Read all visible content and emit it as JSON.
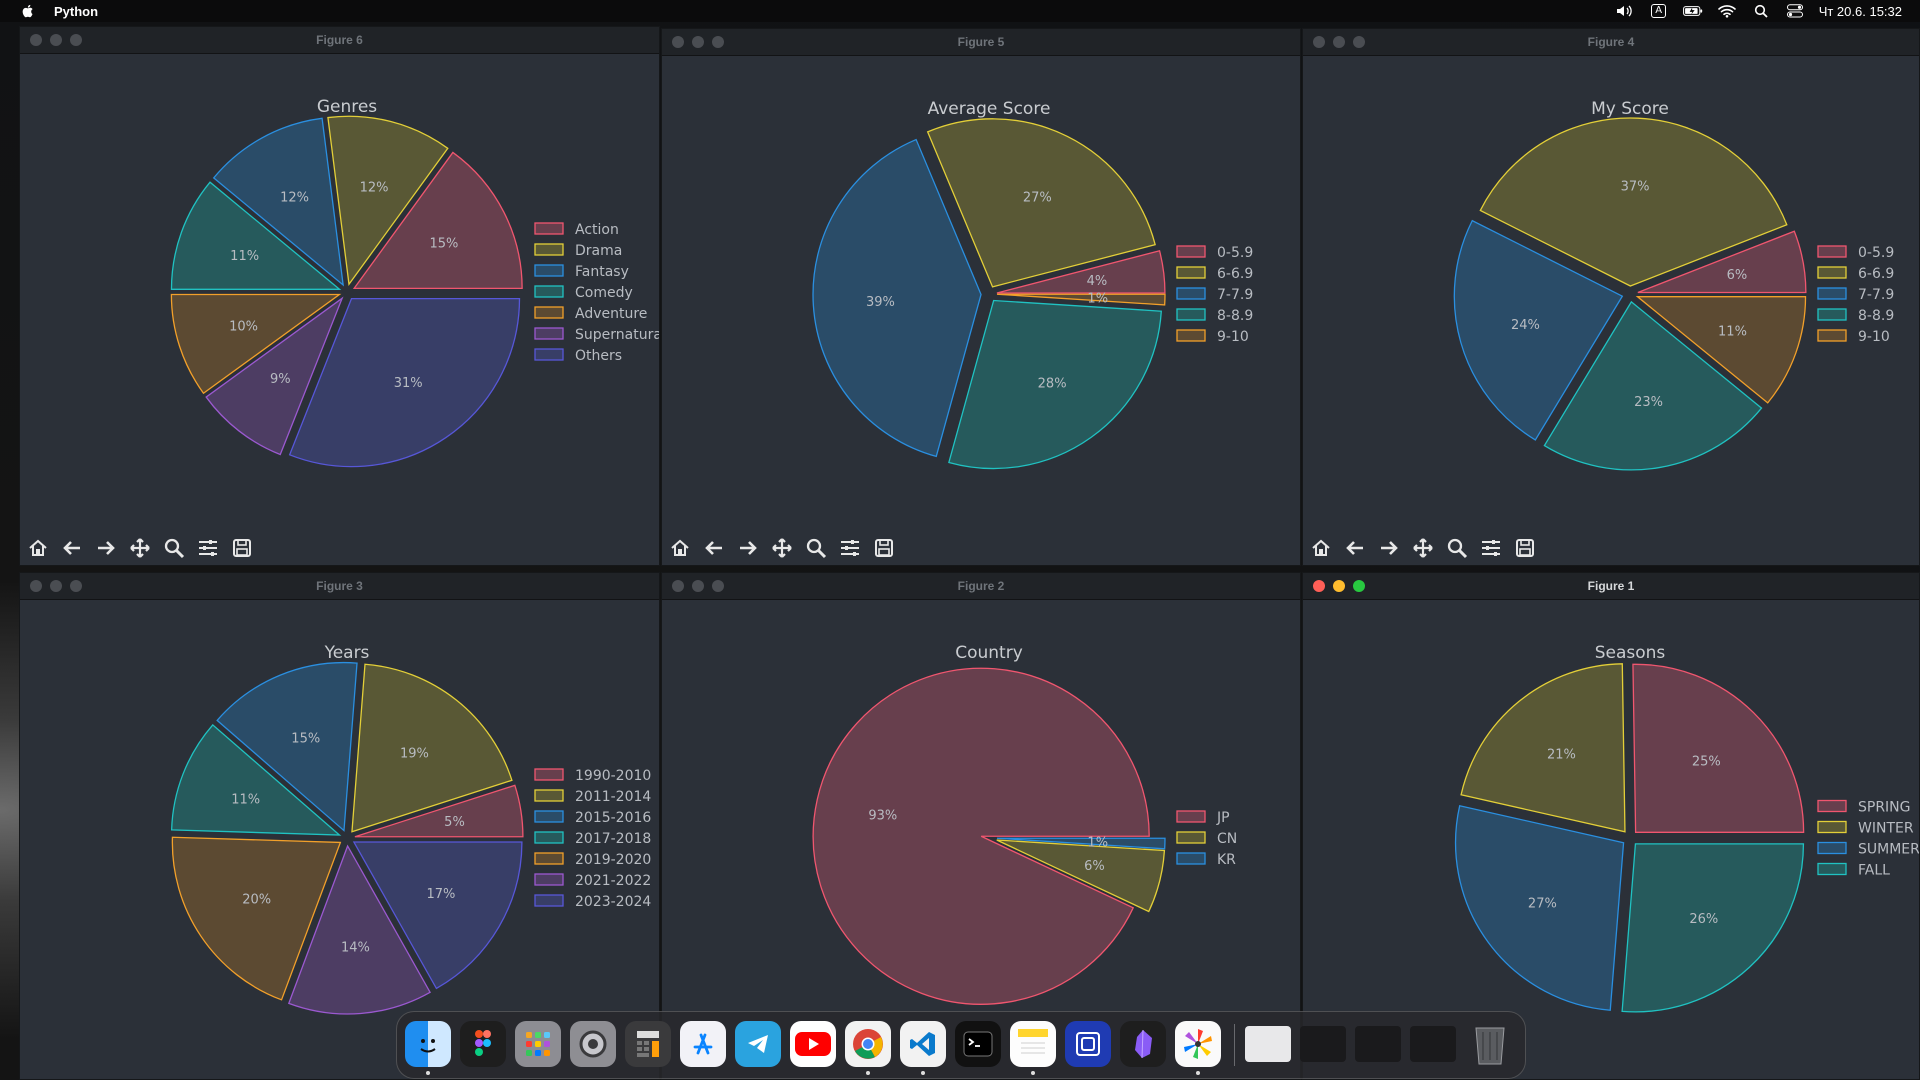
{
  "menubar": {
    "app_name": "Python",
    "clock": "Чт 20.6.  15:32",
    "input_source": "A"
  },
  "colors": {
    "fg1": "#f0566f",
    "fg2": "#e3cf38",
    "fg3": "#2a8fe0",
    "fg4": "#20c2c2",
    "fg5": "#f2a02a",
    "fg6": "#9b59d0",
    "fg7": "#5757d8",
    "fill1": "#673f4d",
    "fill2": "#595835",
    "fill3": "#2a4c68",
    "fill4": "#265a5c",
    "fill5": "#5c4a32",
    "fill6": "#4d3d63",
    "fill7": "#383e67"
  },
  "toolbar_icons": [
    "home-icon",
    "back-arrow-icon",
    "forward-arrow-icon",
    "pan-icon",
    "zoom-icon",
    "configure-subplots-icon",
    "save-icon"
  ],
  "windows": [
    {
      "id": "fig6",
      "title": "Figure 6",
      "active": false,
      "chart_data": {
        "type": "pie",
        "title": "Genres",
        "labels": [
          "Action",
          "Drama",
          "Fantasy",
          "Comedy",
          "Adventure",
          "Supernatura",
          "Others"
        ],
        "values": [
          15,
          12,
          12,
          11,
          10,
          9,
          31
        ],
        "pct_labels": [
          "15%",
          "12%",
          "12%",
          "11%",
          "10%",
          "9%",
          "31%"
        ],
        "legend": "right"
      }
    },
    {
      "id": "fig5",
      "title": "Figure 5",
      "active": false,
      "chart_data": {
        "type": "pie",
        "title": "Average Score",
        "labels": [
          "0-5.9",
          "6-6.9",
          "7-7.9",
          "8-8.9",
          "9-10"
        ],
        "values": [
          4,
          27,
          39,
          28,
          1
        ],
        "pct_labels": [
          "4%",
          "27%",
          "39%",
          "28%",
          "1%"
        ],
        "legend": "right"
      }
    },
    {
      "id": "fig4",
      "title": "Figure 4",
      "active": false,
      "chart_data": {
        "type": "pie",
        "title": "My Score",
        "labels": [
          "0-5.9",
          "6-6.9",
          "7-7.9",
          "8-8.9",
          "9-10"
        ],
        "values": [
          6,
          37,
          24,
          23,
          11
        ],
        "pct_labels": [
          "6%",
          "37%",
          "24%",
          "23%",
          "11%"
        ],
        "legend": "right"
      }
    },
    {
      "id": "fig3",
      "title": "Figure 3",
      "active": false,
      "chart_data": {
        "type": "pie",
        "title": "Years",
        "labels": [
          "1990-2010",
          "2011-2014",
          "2015-2016",
          "2017-2018",
          "2019-2020",
          "2021-2022",
          "2023-2024"
        ],
        "values": [
          5,
          19,
          15,
          11,
          20,
          14,
          17
        ],
        "pct_labels": [
          "5%",
          "19%",
          "15%",
          "11%",
          "20%",
          "14%",
          "17%"
        ],
        "legend": "right"
      }
    },
    {
      "id": "fig2",
      "title": "Figure 2",
      "active": false,
      "chart_data": {
        "type": "pie",
        "title": "Country",
        "labels": [
          "JP",
          "CN",
          "KR"
        ],
        "values": [
          93,
          6,
          1
        ],
        "pct_labels": [
          "93%",
          "6%",
          "1%"
        ],
        "legend": "right"
      }
    },
    {
      "id": "fig1",
      "title": "Figure 1",
      "active": true,
      "chart_data": {
        "type": "pie",
        "title": "Seasons",
        "labels": [
          "SPRING",
          "WINTER",
          "SUMMER",
          "FALL"
        ],
        "values": [
          25,
          21,
          27,
          26
        ],
        "pct_labels": [
          "25%",
          "21%",
          "27%",
          "26%"
        ],
        "legend": "right"
      }
    }
  ],
  "dock": {
    "apps": [
      "finder-icon",
      "figma-icon",
      "launchpad-icon",
      "system-settings-icon",
      "calculator-icon",
      "app-store-icon",
      "telegram-icon",
      "youtube-icon",
      "chrome-icon",
      "vscode-icon",
      "terminal-icon",
      "notes-icon",
      "screen-app-icon",
      "obsidian-icon",
      "pinwheel-app-icon"
    ],
    "running": [
      "finder-icon",
      "chrome-icon",
      "vscode-icon",
      "notes-icon",
      "pinwheel-app-icon"
    ],
    "recent": [
      "recent-window-1",
      "recent-window-2",
      "recent-window-3",
      "recent-window-4"
    ],
    "trash": "trash-icon"
  }
}
